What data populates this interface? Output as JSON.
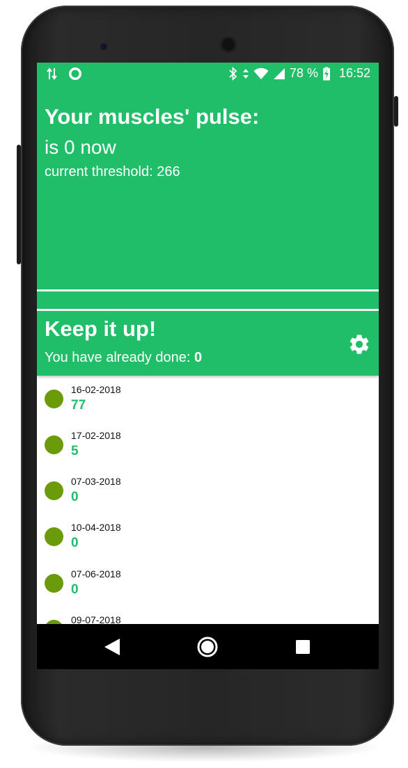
{
  "status_bar": {
    "battery_text": "78 %",
    "time": "16:52",
    "icons": [
      "data-transfer-icon",
      "sync-app-icon",
      "bluetooth-icon",
      "data-arrows-icon",
      "wifi-icon",
      "signal-icon",
      "battery-charging-icon"
    ]
  },
  "pulse": {
    "title": "Your muscles' pulse:",
    "current_value_text": "is 0 now",
    "threshold_text": "current threshold: 266"
  },
  "summary": {
    "title": "Keep it up!",
    "done_label": "You have already done: ",
    "done_count": "0",
    "settings_icon": "gear-icon"
  },
  "sessions": [
    {
      "date": "16-02-2018",
      "value": "77"
    },
    {
      "date": "17-02-2018",
      "value": "5"
    },
    {
      "date": "07-03-2018",
      "value": "0"
    },
    {
      "date": "10-04-2018",
      "value": "0"
    },
    {
      "date": "07-06-2018",
      "value": "0"
    },
    {
      "date": "09-07-2018",
      "value": ""
    }
  ],
  "colors": {
    "accent_green": "#21be6a",
    "dot_green": "#6b9a0a"
  },
  "nav": {
    "back_icon": "back-triangle-icon",
    "home_icon": "home-circle-icon",
    "recents_icon": "recents-square-icon"
  }
}
